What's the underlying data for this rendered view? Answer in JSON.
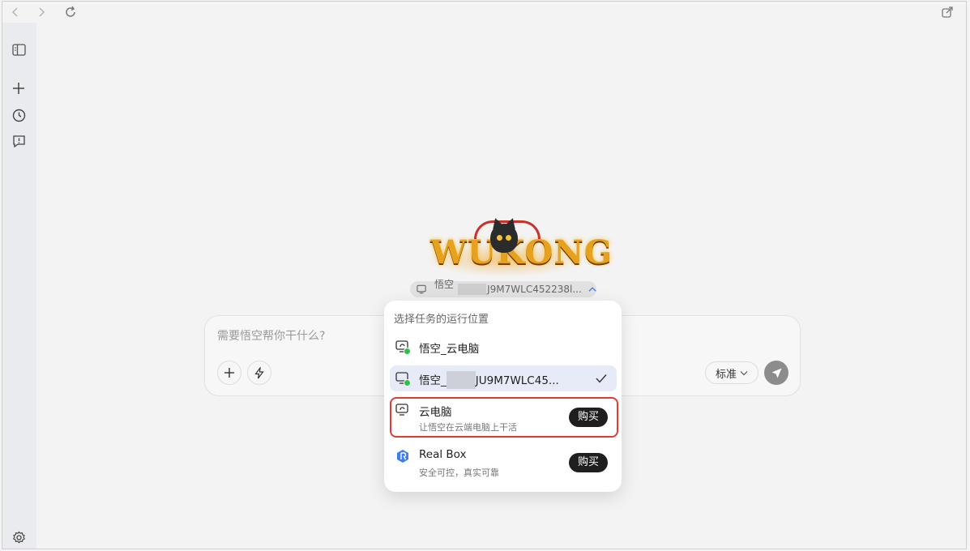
{
  "toolbar": {
    "back_icon": "chevron-left-icon",
    "forward_icon": "chevron-right-icon",
    "reload_icon": "reload-icon",
    "share_icon": "external-share-icon"
  },
  "sidebar": {
    "items": [
      {
        "icon": "panel-toggle-icon"
      },
      {
        "icon": "plus-icon"
      },
      {
        "icon": "history-clock-icon"
      },
      {
        "icon": "feedback-icon"
      }
    ],
    "settings_icon": "gear-icon"
  },
  "logo": {
    "text": "WUKONG"
  },
  "device_pill": {
    "prefix": "悟空_",
    "suffix": "J9M7WLC452238l...",
    "chevron": "chevron-up-icon"
  },
  "input": {
    "placeholder": "需要悟空帮你干什么?",
    "mode_label": "标准"
  },
  "dropdown": {
    "header": "选择任务的运行位置",
    "items": [
      {
        "title": "悟空_云电脑",
        "icon": "cloud-monitor-icon",
        "status": "online"
      },
      {
        "title_prefix": "悟空_",
        "title_suffix": "JU9M7WLC45...",
        "icon": "monitor-icon",
        "status": "online",
        "selected": true
      },
      {
        "title": "云电脑",
        "subtitle": "让悟空在云端电脑上干活",
        "button": "购买",
        "icon": "cloud-monitor-icon"
      },
      {
        "title": "Real Box",
        "subtitle": "安全可控，真实可靠",
        "button": "购买",
        "icon": "realbox-logo-icon"
      }
    ]
  },
  "colors": {
    "accent_selected": "#e6ebf7",
    "online_green": "#29c34a",
    "highlight_red": "#e53935",
    "buy_button": "#1f1f1f"
  }
}
